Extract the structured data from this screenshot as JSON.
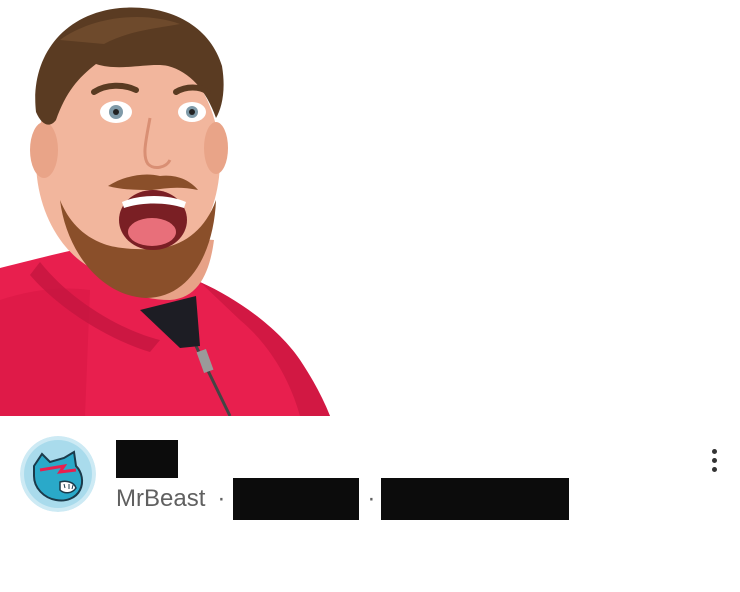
{
  "video": {
    "thumbnail_icon": "person-surprised-thumbnail",
    "title_redacted": true,
    "channel_name": "MrBeast",
    "separator": "·",
    "views_redacted": true,
    "age_redacted": true
  },
  "icons": {
    "avatar": "panther-logo-icon",
    "menu": "more-vert-icon"
  },
  "colors": {
    "hoodie": "#e81f4e",
    "redaction": "#0c0c0c",
    "meta_text": "#606060",
    "avatar_teal": "#2aa9c9"
  }
}
